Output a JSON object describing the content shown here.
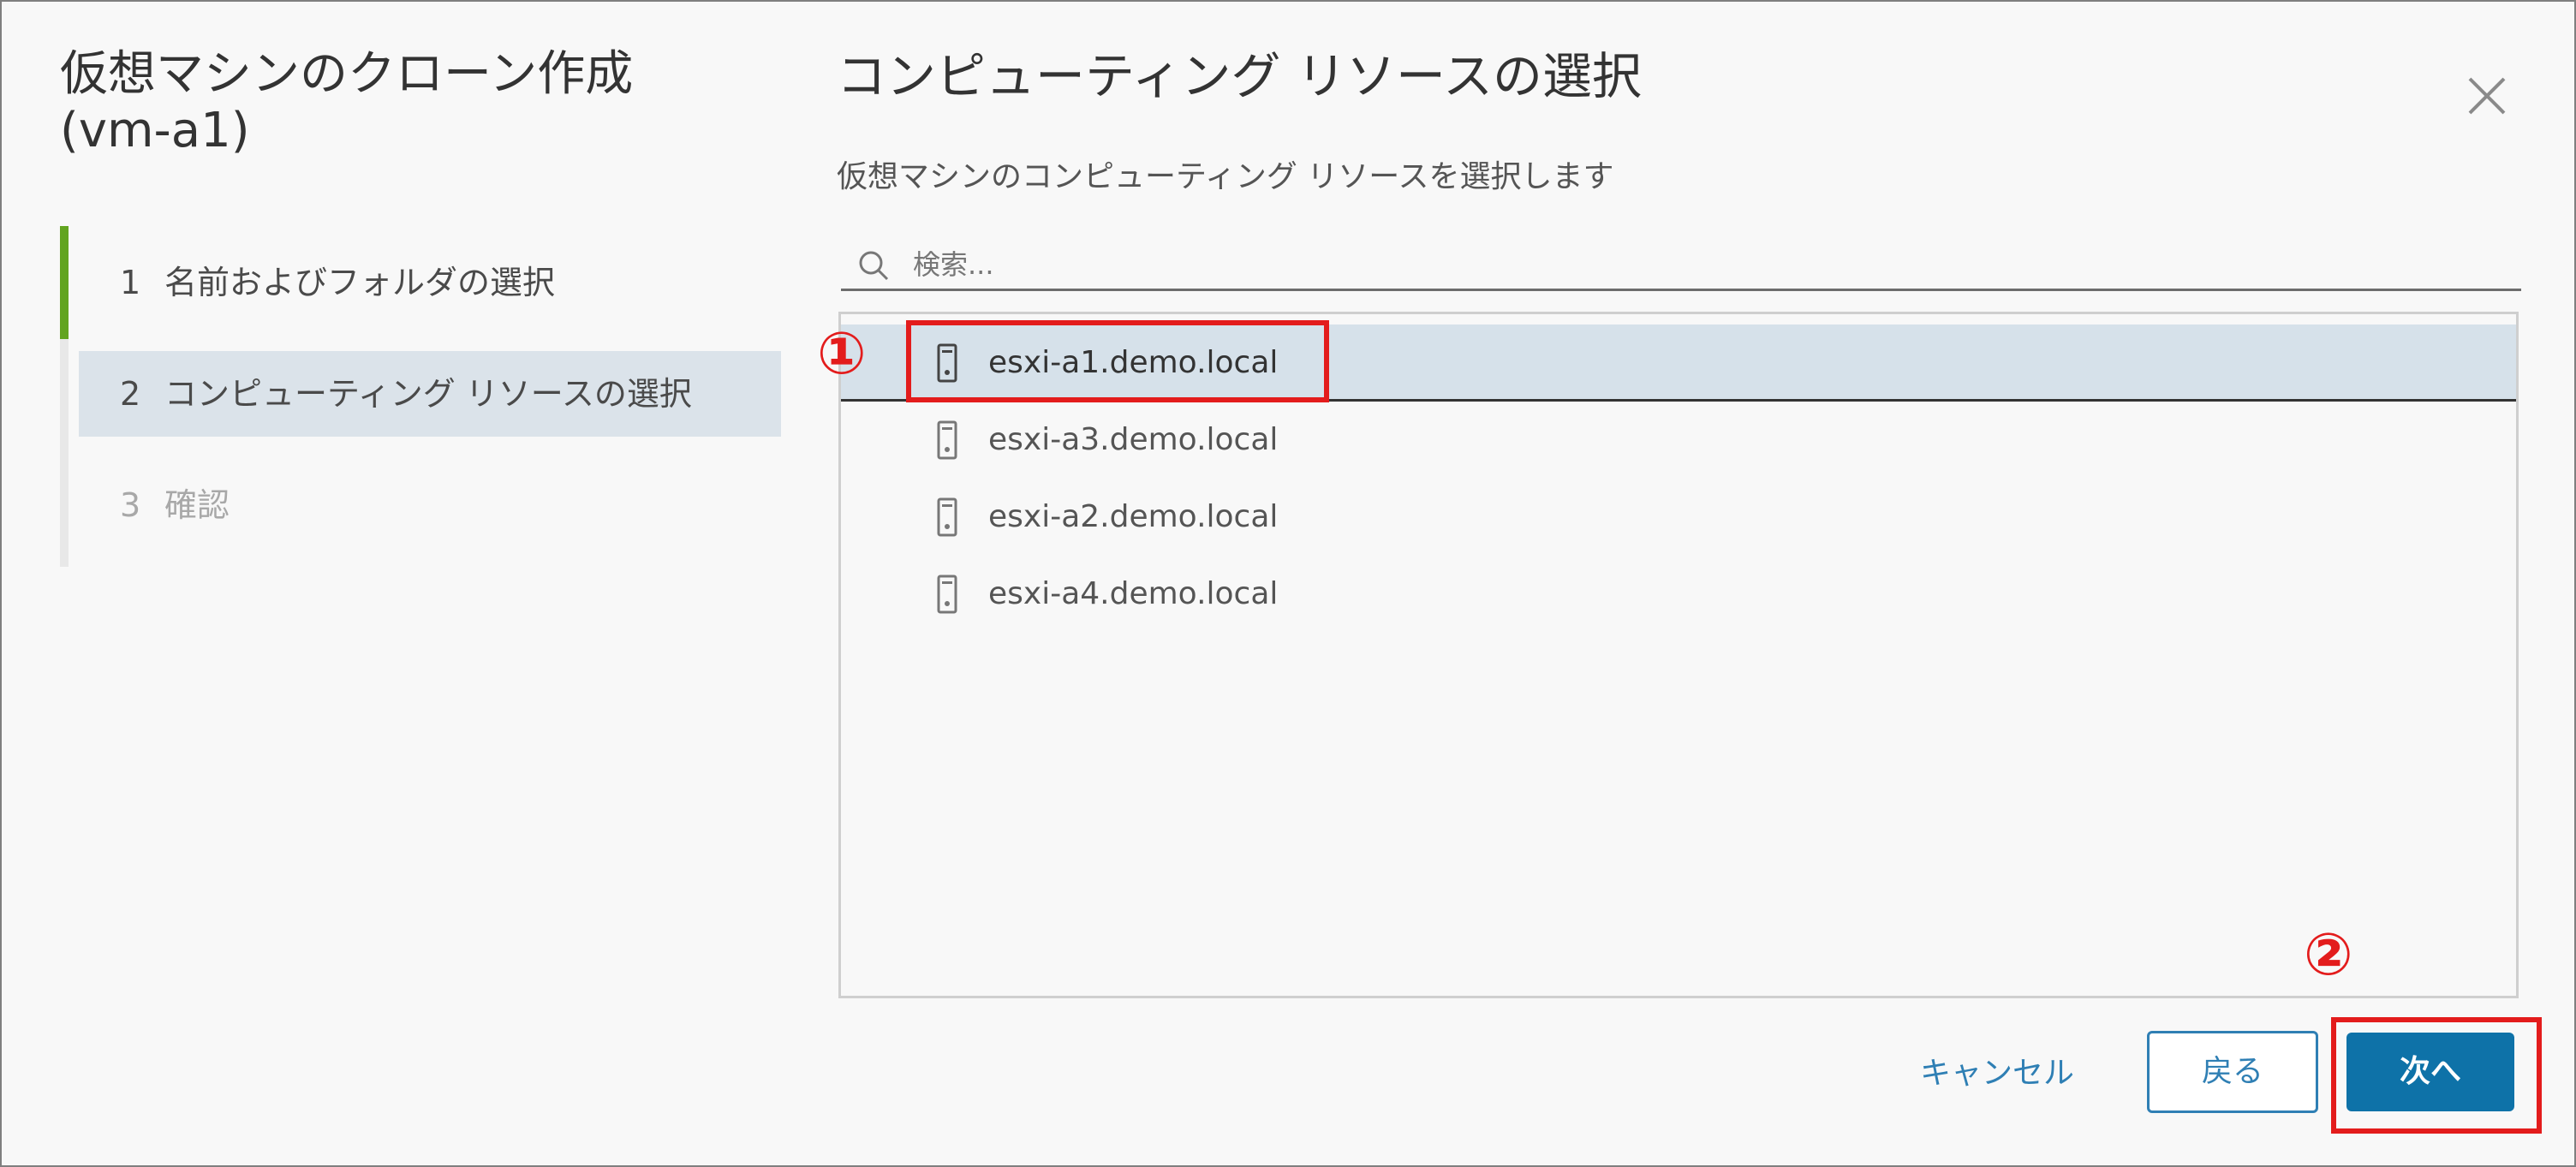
{
  "wizard": {
    "title_line1": "仮想マシンのクローン作成",
    "title_line2": "(vm-a1)",
    "steps": [
      {
        "number": "1",
        "label": "名前およびフォルダの選択",
        "state": "completed"
      },
      {
        "number": "2",
        "label": "コンピューティング リソースの選択",
        "state": "active"
      },
      {
        "number": "3",
        "label": "確認",
        "state": "disabled"
      }
    ]
  },
  "page": {
    "title": "コンピューティング リソースの選択",
    "subtitle": "仮想マシンのコンピューティング リソースを選択します",
    "close_icon": "close-icon"
  },
  "search": {
    "placeholder": "検索...",
    "value": "",
    "icon": "search-icon"
  },
  "hosts": [
    {
      "name": "esxi-a1.demo.local",
      "selected": true,
      "icon": "host-icon"
    },
    {
      "name": "esxi-a3.demo.local",
      "selected": false,
      "icon": "host-icon"
    },
    {
      "name": "esxi-a2.demo.local",
      "selected": false,
      "icon": "host-icon"
    },
    {
      "name": "esxi-a4.demo.local",
      "selected": false,
      "icon": "host-icon"
    }
  ],
  "footer": {
    "cancel_label": "キャンセル",
    "back_label": "戻る",
    "next_label": "次へ"
  },
  "annotations": {
    "marker1": "①",
    "marker2": "②",
    "color": "#e31c1c"
  },
  "colors": {
    "accent": "#0e72a8",
    "link": "#2f7fb4",
    "progress_done": "#62a420",
    "active_step_bg": "#dbe3ea",
    "selected_row_bg": "#d6e1ea"
  }
}
